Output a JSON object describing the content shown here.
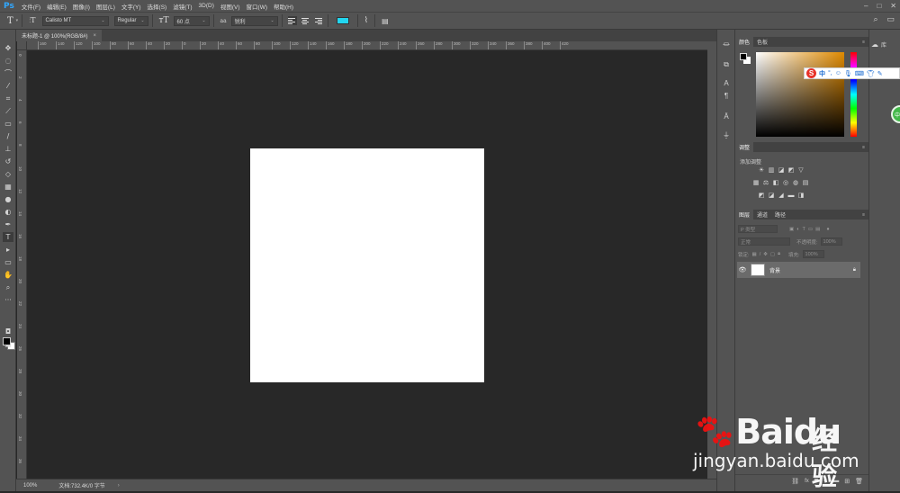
{
  "app": {
    "logo": "Ps",
    "menu": [
      "文件(F)",
      "编辑(E)",
      "图像(I)",
      "图层(L)",
      "文字(Y)",
      "选择(S)",
      "滤镜(T)",
      "3D(D)",
      "视图(V)",
      "窗口(W)",
      "帮助(H)"
    ],
    "window_controls": [
      "–",
      "□",
      "✕"
    ]
  },
  "options": {
    "tool_icon": "T",
    "font_family": "Calisto MT",
    "font_style": "Regular",
    "font_size": "60 点",
    "antialias_icon": "aa",
    "antialias": "锐利",
    "text_color": "#22d6f0"
  },
  "document": {
    "tab_title": "未标题-1 @ 100%(RGB/8#)",
    "close_icon": "×",
    "zoom": "100%",
    "doc_info": "文档:732.4K/0 字节"
  },
  "ruler": {
    "h_labels": [
      "160",
      "140",
      "120",
      "100",
      "80",
      "60",
      "40",
      "20",
      "0",
      "20",
      "40",
      "60",
      "80",
      "100",
      "120",
      "140",
      "160",
      "180",
      "200",
      "220",
      "240",
      "260",
      "280",
      "300",
      "320",
      "340",
      "360",
      "380",
      "400",
      "420"
    ],
    "v_labels": [
      "0",
      "2",
      "4",
      "6",
      "8",
      "10",
      "12",
      "14",
      "16",
      "18",
      "20",
      "22",
      "24",
      "26",
      "28",
      "30",
      "32",
      "34",
      "36"
    ]
  },
  "panels": {
    "color": {
      "tabs": [
        "颜色",
        "色板"
      ]
    },
    "adjustments": {
      "tab": "调整",
      "add_label": "添加调整"
    },
    "layers": {
      "tabs": [
        "图层",
        "通道",
        "路径"
      ],
      "kind_filter": "P 类型",
      "blend_mode": "正常",
      "opacity_label": "不透明度:",
      "opacity_value": "100%",
      "lock_label": "锁定:",
      "fill_label": "填充:",
      "fill_value": "100%",
      "layer_items": [
        {
          "name": "背景",
          "visible": true,
          "locked": true
        }
      ],
      "footer_icons": [
        "link-icon",
        "fx-icon",
        "mask-icon",
        "adjustment-icon",
        "group-icon",
        "new-layer-icon",
        "trash-icon"
      ]
    }
  },
  "libraries": {
    "label": "库"
  },
  "ime": {
    "label": "中"
  },
  "badge": {
    "text": "中国"
  },
  "watermark": {
    "brand_en": "Baidu",
    "brand_cn": "经验",
    "url": "jingyan.baidu.com"
  }
}
